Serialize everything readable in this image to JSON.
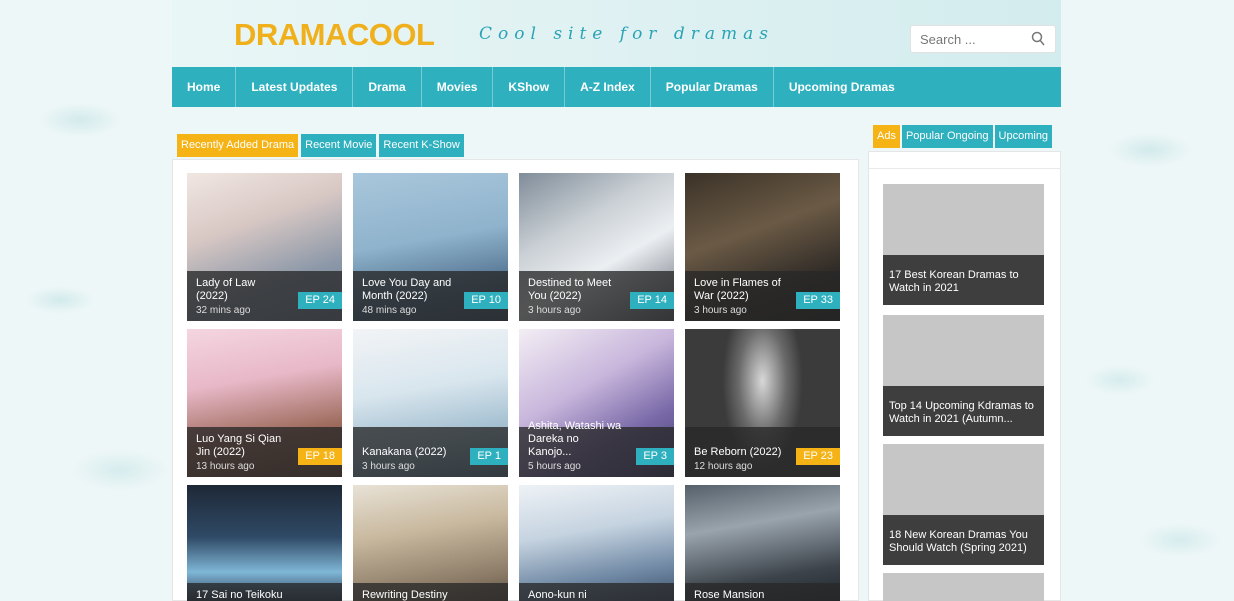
{
  "header": {
    "logo_part1": "DRAMA",
    "logo_part2": "C",
    "logo_oo": "OO",
    "logo_part3": "L",
    "tagline": "Cool site for dramas",
    "search_placeholder": "Search ..."
  },
  "nav": {
    "items": [
      "Home",
      "Latest Updates",
      "Drama",
      "Movies",
      "KShow",
      "A-Z Index",
      "Popular Dramas",
      "Upcoming Dramas"
    ]
  },
  "content_tabs": [
    "Recently Added Drama",
    "Recent Movie",
    "Recent K-Show"
  ],
  "sidebar_tabs": [
    "Ads",
    "Popular Ongoing",
    "Upcoming"
  ],
  "colors": {
    "accent": "#2fb0bf",
    "highlight": "#f5b316"
  },
  "dramas": [
    {
      "title": "Lady of Law (2022)",
      "time": "32 mins ago",
      "ep": "EP 24",
      "ep_color": "teal"
    },
    {
      "title": "Love You Day and Month (2022)",
      "time": "48 mins ago",
      "ep": "EP 10",
      "ep_color": "teal"
    },
    {
      "title": "Destined to Meet You (2022)",
      "time": "3 hours ago",
      "ep": "EP 14",
      "ep_color": "teal"
    },
    {
      "title": "Love in Flames of War (2022)",
      "time": "3 hours ago",
      "ep": "EP 33",
      "ep_color": "teal"
    },
    {
      "title": "Luo Yang Si Qian Jin (2022)",
      "time": "13 hours ago",
      "ep": "EP 18",
      "ep_color": "orange"
    },
    {
      "title": "Kanakana (2022)",
      "time": "3 hours ago",
      "ep": "EP 1",
      "ep_color": "teal"
    },
    {
      "title": "Ashita, Watashi wa Dareka no Kanojo...",
      "time": "5 hours ago",
      "ep": "EP 3",
      "ep_color": "teal"
    },
    {
      "title": "Be Reborn (2022)",
      "time": "12 hours ago",
      "ep": "EP 23",
      "ep_color": "orange"
    },
    {
      "title": "17 Sai no Teikoku",
      "time": "",
      "ep": "",
      "ep_color": ""
    },
    {
      "title": "Rewriting Destiny",
      "time": "",
      "ep": "",
      "ep_color": ""
    },
    {
      "title": "Aono-kun ni",
      "time": "",
      "ep": "",
      "ep_color": ""
    },
    {
      "title": "Rose Mansion",
      "time": "",
      "ep": "",
      "ep_color": ""
    }
  ],
  "articles": [
    {
      "caption": "17 Best Korean Dramas to Watch in 2021"
    },
    {
      "caption": "Top 14 Upcoming Kdramas to Watch in 2021 (Autumn..."
    },
    {
      "caption": "18 New Korean Dramas You Should Watch (Spring 2021)"
    },
    {
      "caption": ""
    }
  ]
}
